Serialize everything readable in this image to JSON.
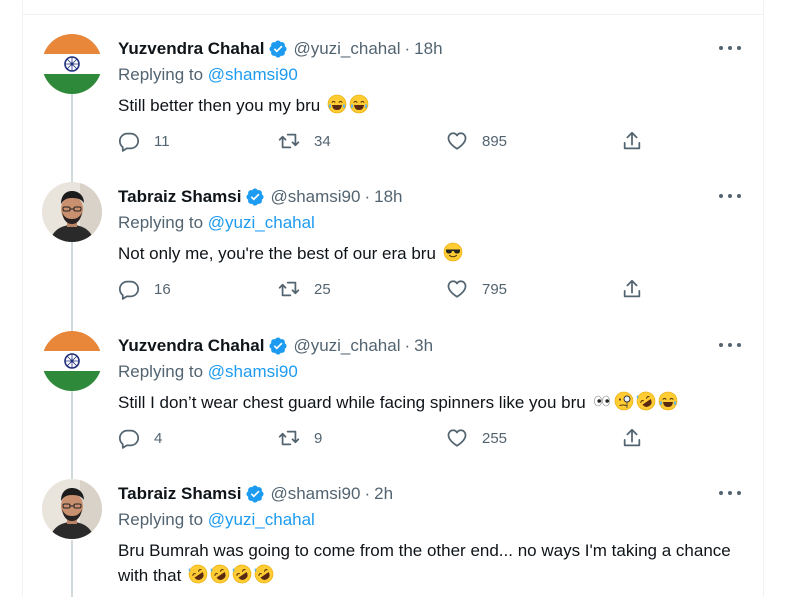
{
  "colors": {
    "accent": "#1d9bf0",
    "muted": "#536471",
    "text": "#0f1419",
    "thread_line": "#cfd9de"
  },
  "tweets": [
    {
      "name": "Yuzvendra Chahal",
      "handle": "@yuzi_chahal",
      "sep": "·",
      "time": "18h",
      "replying_prefix": "Replying to",
      "replying_to": "@shamsi90",
      "text": "Still better then you my bru",
      "emojis": [
        "face-with-tears-of-joy",
        "face-with-tears-of-joy"
      ],
      "avatar": "india-flag",
      "replies": "11",
      "retweets": "34",
      "likes": "895"
    },
    {
      "name": "Tabraiz Shamsi",
      "handle": "@shamsi90",
      "sep": "·",
      "time": "18h",
      "replying_prefix": "Replying to",
      "replying_to": "@yuzi_chahal",
      "text": "Not only me, you're the best of our era bru",
      "emojis": [
        "smiling-face-with-sunglasses"
      ],
      "avatar": "profile-photo",
      "replies": "16",
      "retweets": "25",
      "likes": "795"
    },
    {
      "name": "Yuzvendra Chahal",
      "handle": "@yuzi_chahal",
      "sep": "·",
      "time": "3h",
      "replying_prefix": "Replying to",
      "replying_to": "@shamsi90",
      "text": "Still I don’t wear chest guard while facing spinners like you bru",
      "emojis": [
        "eyes",
        "face-with-monocle",
        "rolling-on-the-floor-laughing",
        "face-with-tears-of-joy"
      ],
      "avatar": "india-flag",
      "replies": "4",
      "retweets": "9",
      "likes": "255"
    },
    {
      "name": "Tabraiz Shamsi",
      "handle": "@shamsi90",
      "sep": "·",
      "time": "2h",
      "replying_prefix": "Replying to",
      "replying_to": "@yuzi_chahal",
      "text": "Bru Bumrah was going to come from the other end... no ways I'm taking a chance with that",
      "emojis": [
        "rolling-on-the-floor-laughing",
        "rolling-on-the-floor-laughing",
        "rolling-on-the-floor-laughing",
        "rolling-on-the-floor-laughing"
      ],
      "avatar": "profile-photo"
    }
  ]
}
